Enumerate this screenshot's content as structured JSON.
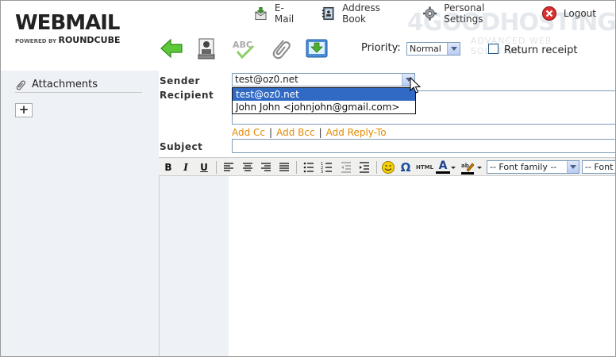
{
  "logo": {
    "main": "WEBMAIL",
    "powered": "POWERED BY",
    "brand": "ROUNDCUBE"
  },
  "watermark": {
    "main": "4GOODHOSTING",
    "sub": "ADVANCED WEB SOLUTIONS"
  },
  "topnav": {
    "email": "E-Mail",
    "addressbook": "Address Book",
    "settings": "Personal Settings",
    "logout": "Logout"
  },
  "toolbar": {
    "priority_label": "Priority:",
    "priority_value": "Normal",
    "return_receipt": "Return receipt"
  },
  "sidebar": {
    "attachments": "Attachments",
    "add": "+"
  },
  "form": {
    "sender_label": "Sender",
    "recipient_label": "Recipient",
    "subject_label": "Subject",
    "sender_value": "test@oz0.net",
    "sender_options": [
      "test@oz0.net",
      "John John <johnjohn@gmail.com>"
    ],
    "add_cc": "Add Cc",
    "add_bcc": "Add Bcc",
    "add_reply_to": "Add Reply-To",
    "link_sep": "|"
  },
  "editor": {
    "bold": "B",
    "italic": "I",
    "underline": "U",
    "omega": "Ω",
    "html": "HTML",
    "font_color": "A",
    "font_family": "-- Font family --",
    "font_size": "-- Font s"
  },
  "colors": {
    "accent_link": "#e38b00",
    "selection": "#316ac5"
  }
}
